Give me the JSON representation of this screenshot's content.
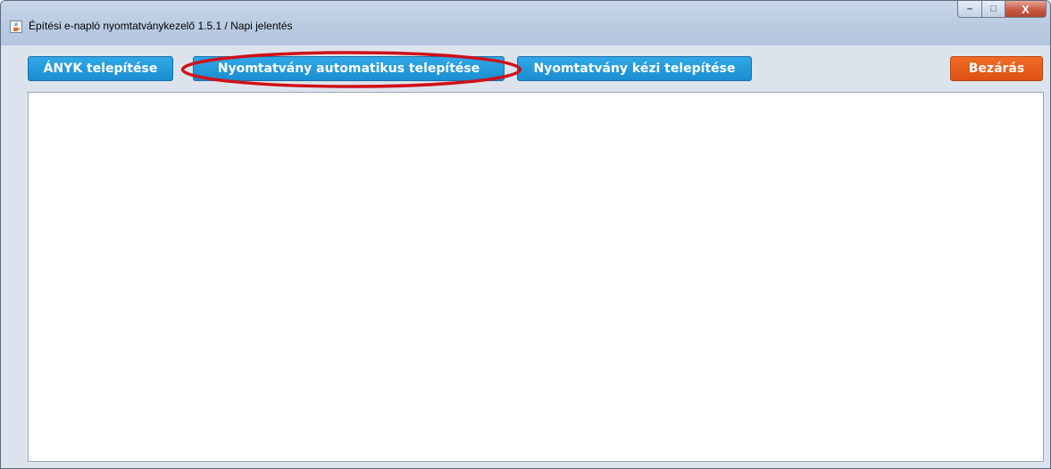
{
  "window": {
    "title": "Építési e-napló nyomtatványkezelő 1.5.1 / Napi jelentés",
    "icon": "java-cup-icon",
    "controls": {
      "minimize": "–",
      "maximize": "□",
      "close": "X"
    }
  },
  "toolbar": {
    "anyk_install": "ÁNYK telepítése",
    "auto_install": "Nyomtatvány automatikus telepítése",
    "manual_install": "Nyomtatvány kézi telepítése",
    "close": "Bezárás"
  },
  "colors": {
    "button_blue": "#1a8dd0",
    "button_orange": "#e2561a",
    "highlight_red": "#d0101a",
    "window_bg": "#dde3ec"
  },
  "annotation": {
    "highlighted_element": "auto_install"
  }
}
